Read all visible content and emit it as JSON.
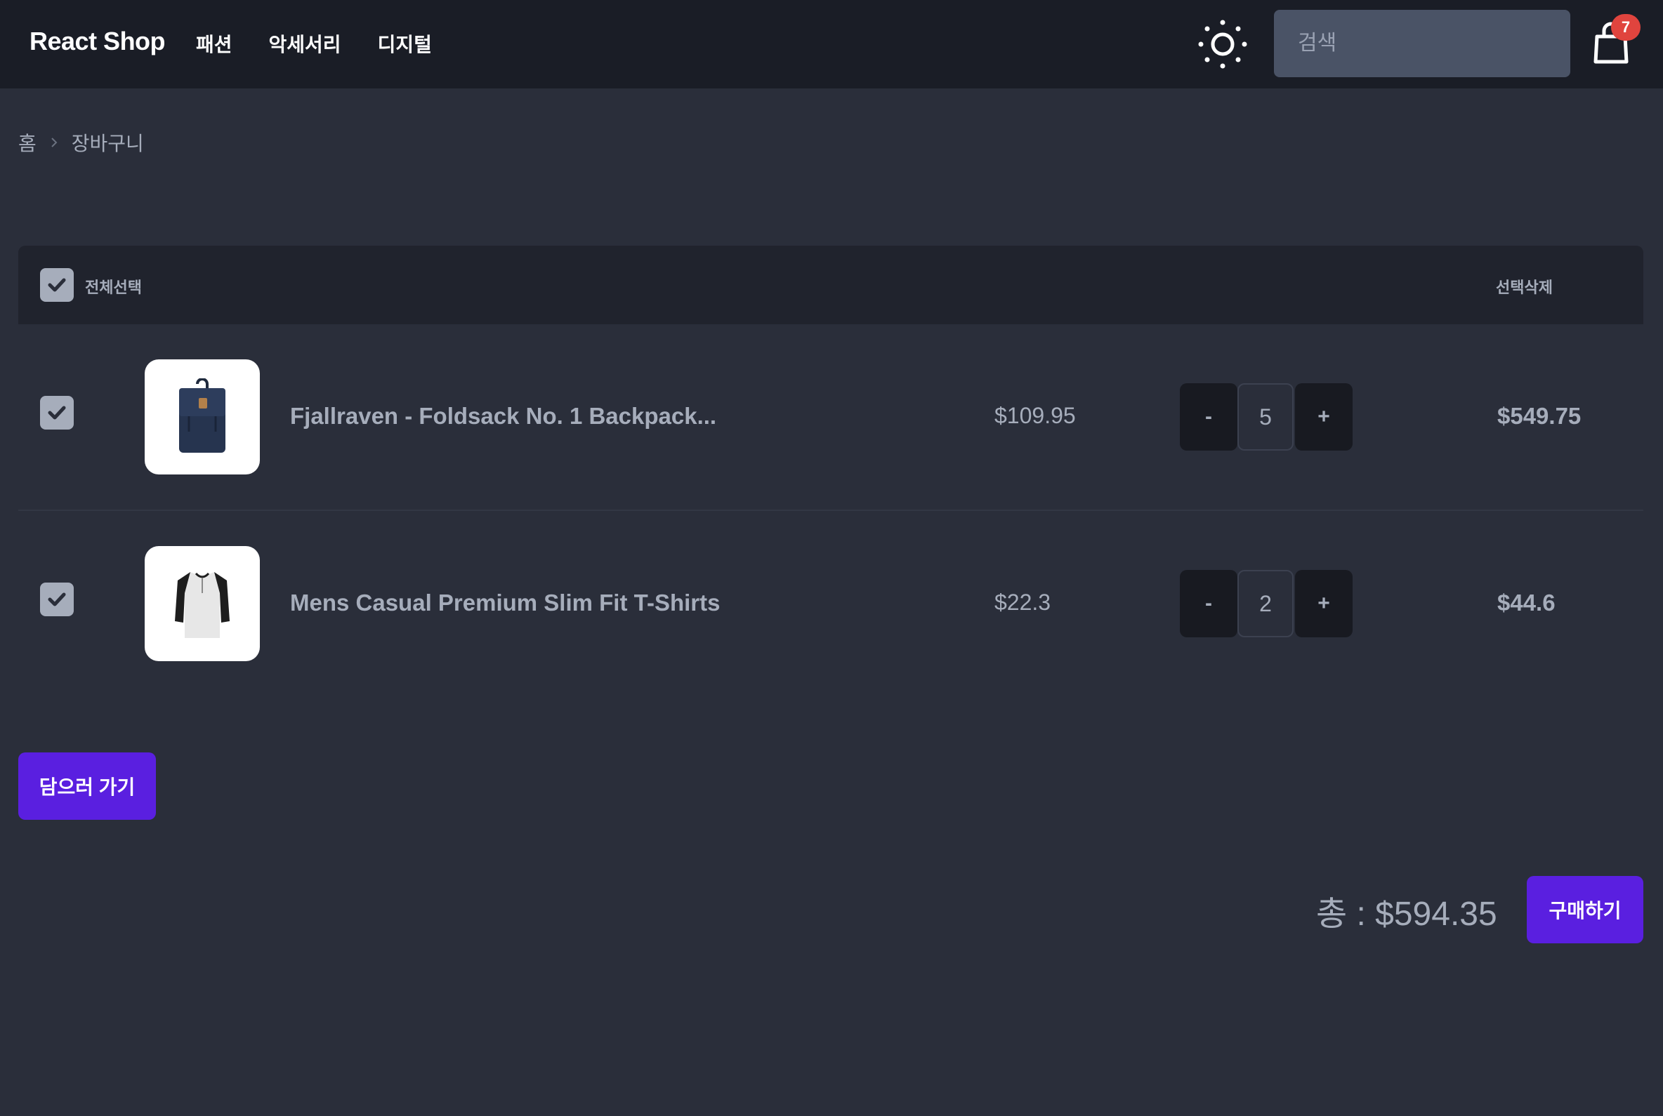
{
  "header": {
    "brand": "React Shop",
    "nav": [
      "패션",
      "악세서리",
      "디지털"
    ],
    "search_placeholder": "검색",
    "cart_count": "7",
    "theme_icon": "sun-icon",
    "cart_icon": "shopping-bag-icon"
  },
  "breadcrumb": {
    "home": "홈",
    "current": "장바구니"
  },
  "cart": {
    "select_all_label": "전체선택",
    "delete_selected_label": "선택삭제",
    "items": [
      {
        "title": "Fjallraven - Foldsack No. 1 Backpack...",
        "unit_price": "$109.95",
        "quantity": "5",
        "line_total": "$549.75",
        "checked": true
      },
      {
        "title": "Mens Casual Premium Slim Fit T-Shirts",
        "unit_price": "$22.3",
        "quantity": "2",
        "line_total": "$44.6",
        "checked": true
      }
    ],
    "minus_label": "-",
    "plus_label": "+"
  },
  "actions": {
    "continue_shopping": "담으러 가기",
    "total": "총 : $594.35",
    "purchase": "구매하기"
  },
  "colors": {
    "navbar_bg": "#1a1d26",
    "page_bg": "#2a2e3a",
    "primary": "#5a1fe0",
    "badge": "#e0443e"
  }
}
